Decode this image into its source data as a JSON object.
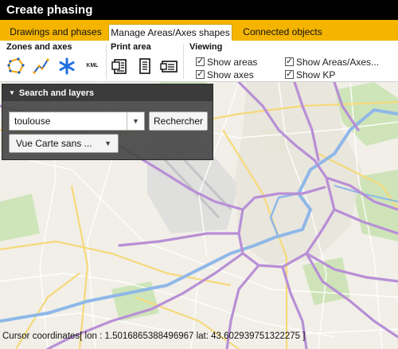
{
  "window": {
    "title": "Create phasing"
  },
  "tabs": [
    {
      "label": "Drawings and phases"
    },
    {
      "label": "Manage Areas/Axes shapes"
    },
    {
      "label": "Connected objects"
    }
  ],
  "ribbon": {
    "zones_title": "Zones and axes",
    "zone_tools": [
      "polygon-icon",
      "polyline-icon",
      "star-icon",
      "kml-icon"
    ],
    "kml_label": "KML",
    "print_title": "Print area",
    "print_tools": [
      "print-landscape-icon",
      "print-portrait-icon",
      "print-wide-icon"
    ],
    "viewing_title": "Viewing",
    "viewing": [
      {
        "label": "Show areas",
        "checked": true
      },
      {
        "label": "Show axes",
        "checked": true
      },
      {
        "label": "Show Areas/Axes...",
        "checked": true
      },
      {
        "label": "Show KP",
        "checked": true
      }
    ]
  },
  "search_panel": {
    "title": "Search and layers",
    "search_value": "toulouse",
    "search_button": "Rechercher",
    "layer_select": "Vue Carte sans ..."
  },
  "status": {
    "coordinates": "Cursor coordinates[ lon : 1.5016865388496967 lat: 43.602939751322275 ]"
  },
  "colors": {
    "title_bar": "#000000",
    "tab_strip": "#f4b400",
    "highway": "#b88fd6",
    "river": "#8fb8e8",
    "park": "#c8e3b0"
  }
}
